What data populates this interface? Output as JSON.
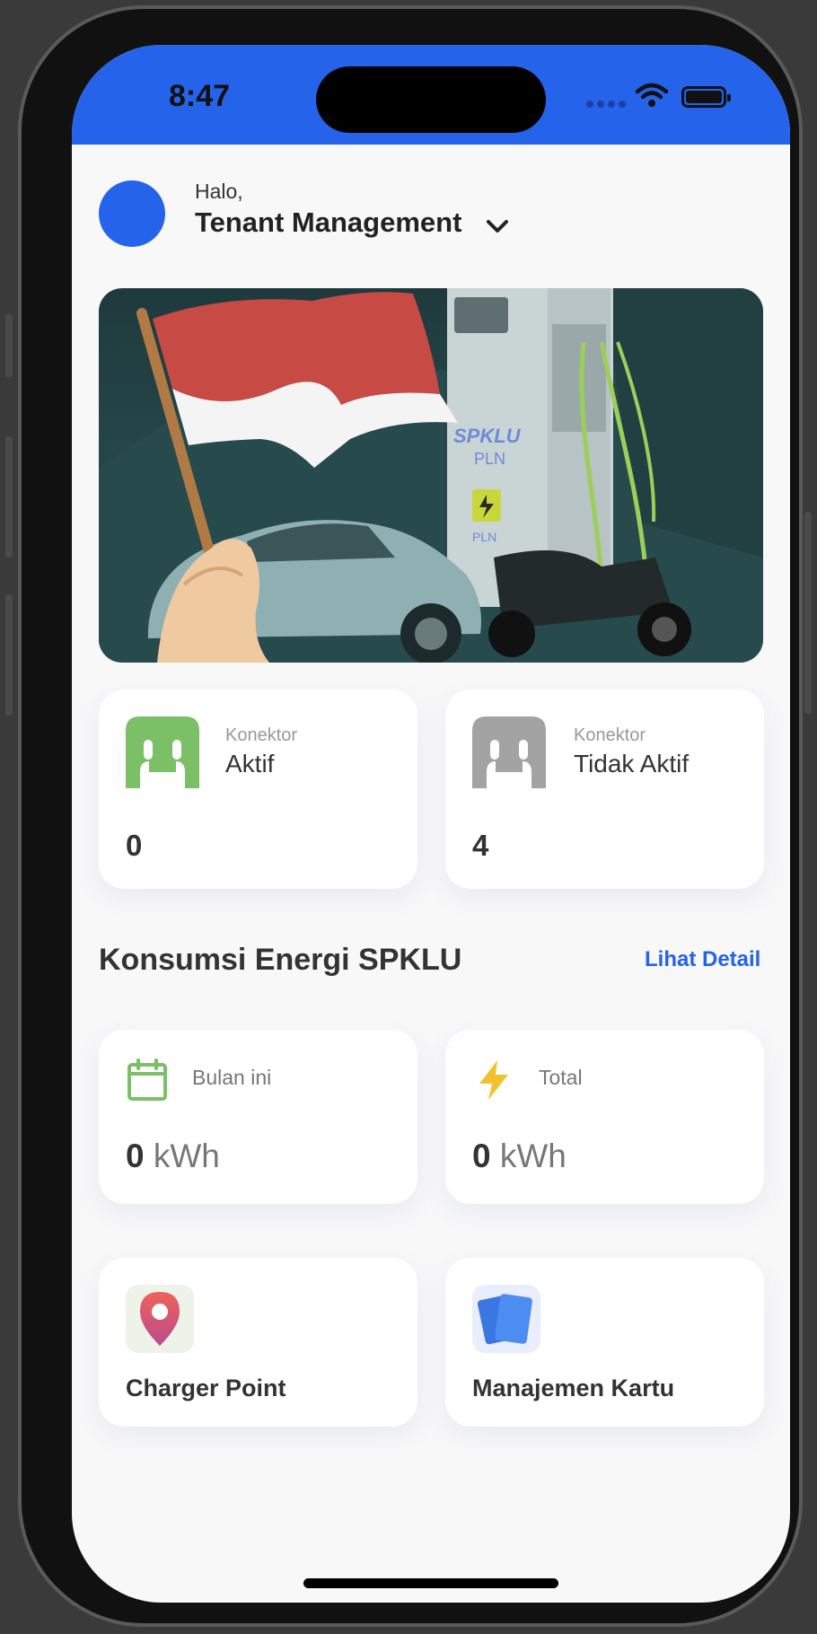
{
  "status_bar": {
    "time": "8:47",
    "color": "#2563eb"
  },
  "header": {
    "greeting": "Halo,",
    "tenant_name": "Tenant Management"
  },
  "connectors": [
    {
      "sub": "Konektor",
      "title": "Aktif",
      "count": "0",
      "color": "#7bc067",
      "icon": "connector-icon"
    },
    {
      "sub": "Konektor",
      "title": "Tidak Aktif",
      "count": "4",
      "color": "#a3a3a3",
      "icon": "connector-icon"
    }
  ],
  "energy": {
    "title": "Konsumsi Energi SPKLU",
    "detail_link": "Lihat Detail",
    "cards": [
      {
        "label": "Bulan ini",
        "value": "0",
        "unit": "kWh",
        "icon": "calendar-icon"
      },
      {
        "label": "Total",
        "value": "0",
        "unit": "kWh",
        "icon": "lightning-icon"
      }
    ]
  },
  "menu": [
    {
      "label": "Charger Point",
      "icon": "location-pin-icon"
    },
    {
      "label": "Manajemen Kartu",
      "icon": "cards-icon"
    }
  ],
  "banner": {
    "charger_brand": "SPKLU",
    "charger_sub": "PLN",
    "badge_text": "PLN"
  }
}
